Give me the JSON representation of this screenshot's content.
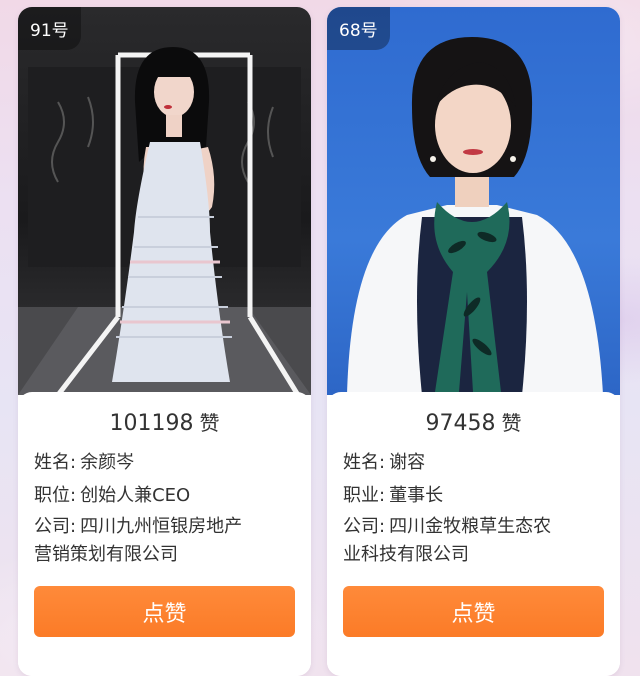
{
  "colors": {
    "accent_button": "#fb7b27",
    "text": "#333333",
    "background": "#ece0f2"
  },
  "cards": [
    {
      "number_label": "91号",
      "likes_count": "101198",
      "likes_unit": "赞",
      "name_label": "姓名:",
      "name_value": "余颜岑",
      "title_label": "职位:",
      "title_value": "创始人兼CEO",
      "company_label": "公司:",
      "company_value_line1": "四川九州恒银房地产",
      "company_value_line2": "营销策划有限公司",
      "button_label": "点赞"
    },
    {
      "number_label": "68号",
      "likes_count": "97458",
      "likes_unit": "赞",
      "name_label": "姓名:",
      "name_value": "谢容",
      "title_label": "职业:",
      "title_value": "董事长",
      "company_label": "公司:",
      "company_value_line1": "四川金牧粮草生态农",
      "company_value_line2": "业科技有限公司",
      "button_label": "点赞"
    }
  ]
}
